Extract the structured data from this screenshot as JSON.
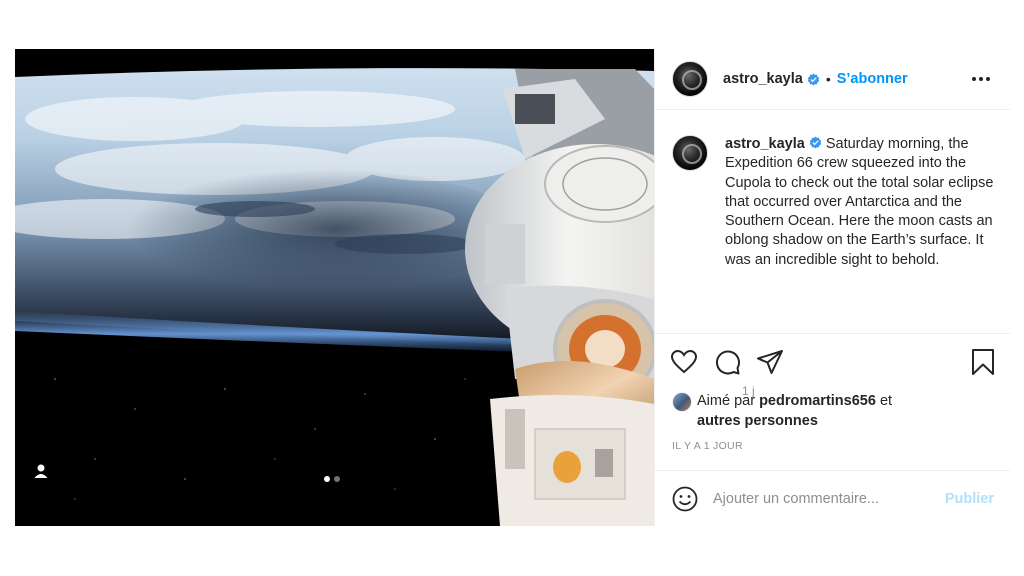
{
  "post": {
    "username": "astro_kayla",
    "follow_label": "S’abonner",
    "separator": "•",
    "caption": "Saturday morning, the Expedition 66 crew squeezed into the Cupola to check out the total solar eclipse that occurred over Antarctica and the Southern Ocean. Here the moon casts an oblong shadow on the Earth’s surface. It was an incredible sight to behold.",
    "caption_age": "1 j",
    "likes_prefix": "Aimé par",
    "likes_user": "pedromartins656",
    "likes_middle": "et",
    "likes_others": "autres personnes",
    "date": "IL Y A 1 JOUR"
  },
  "media": {
    "carousel_pages": 2,
    "carousel_active": 1
  },
  "comment": {
    "placeholder": "Ajouter un commentaire...",
    "publish_label": "Publier"
  },
  "icons": {
    "like": "heart-icon",
    "comment": "comment-icon",
    "share": "share-icon",
    "save": "bookmark-icon",
    "emoji": "emoji-icon",
    "more": "more-icon",
    "verified": "verified-badge-icon",
    "tag": "user-tag-icon"
  },
  "colors": {
    "accent": "#0095f6",
    "publish_disabled": "#b2dffc",
    "text": "#262626",
    "muted": "#8e8e8e"
  }
}
